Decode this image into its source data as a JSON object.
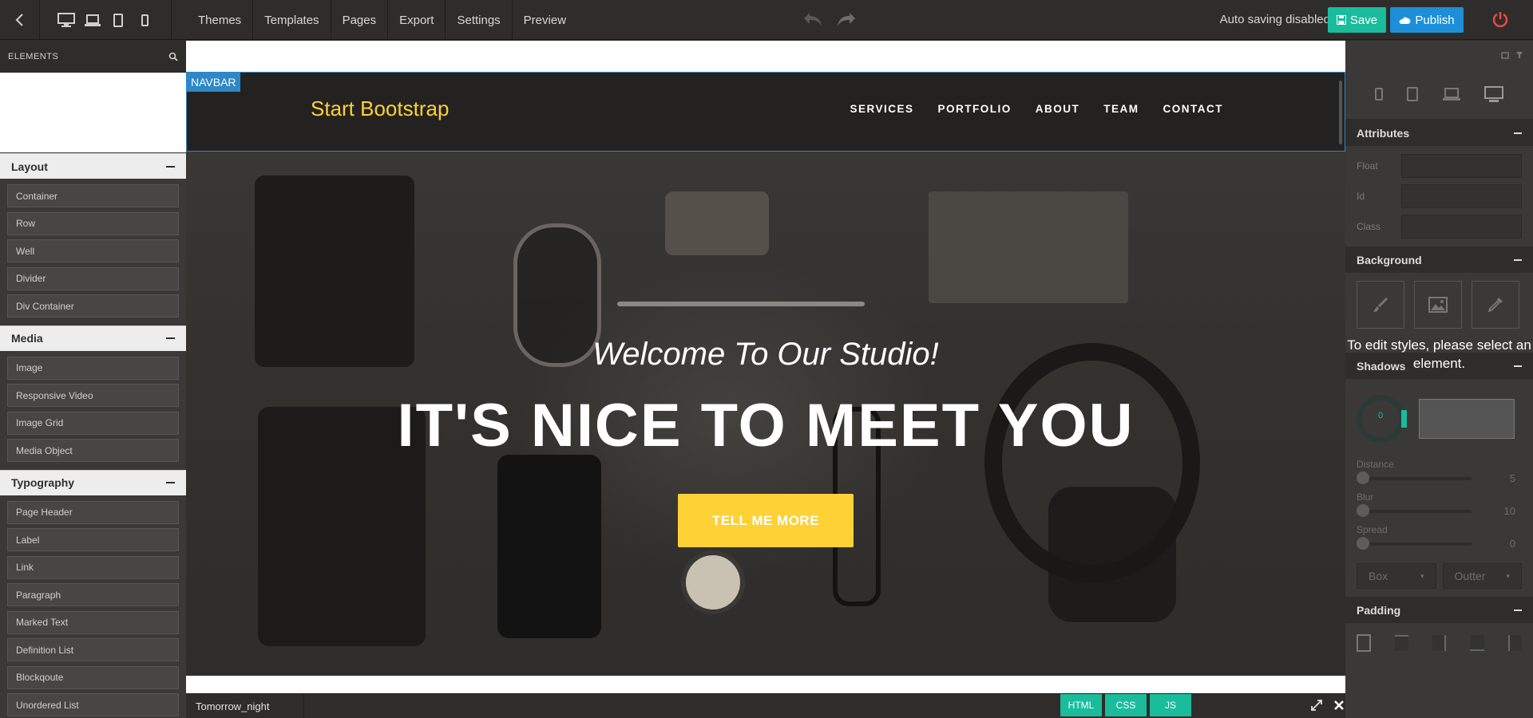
{
  "topbar": {
    "menu": [
      "Themes",
      "Templates",
      "Pages",
      "Export",
      "Settings",
      "Preview"
    ],
    "autosave_text": "Auto saving disabled",
    "save_label": "Save",
    "publish_label": "Publish"
  },
  "left_panel": {
    "header": "ELEMENTS",
    "categories": [
      {
        "name": "Layout",
        "items": [
          "Container",
          "Row",
          "Well",
          "Divider",
          "Div Container"
        ]
      },
      {
        "name": "Media",
        "items": [
          "Image",
          "Responsive Video",
          "Image Grid",
          "Media Object"
        ]
      },
      {
        "name": "Typography",
        "items": [
          "Page Header",
          "Label",
          "Link",
          "Paragraph",
          "Marked Text",
          "Definition List",
          "Blockqoute",
          "Unordered List"
        ]
      }
    ]
  },
  "canvas": {
    "navbar_tag": "NAVBAR",
    "brand": "Start Bootstrap",
    "nav_links": [
      "SERVICES",
      "PORTFOLIO",
      "ABOUT",
      "TEAM",
      "CONTACT"
    ],
    "hero_subtitle": "Welcome To Our Studio!",
    "hero_title": "IT'S NICE TO MEET YOU",
    "hero_button": "TELL ME MORE",
    "accent_color": "#fed136"
  },
  "right_panel": {
    "sections": {
      "attributes": "Attributes",
      "background": "Background",
      "shadows": "Shadows",
      "padding": "Padding"
    },
    "attr_fields": [
      "Float",
      "Id",
      "Class"
    ],
    "bg_tiles": [
      "paint-brush-icon",
      "image-icon",
      "eyedropper-icon"
    ],
    "overlay_message": "To edit styles, please select an element.",
    "shadow_circle_value": "0",
    "sliders": [
      {
        "label": "Distance",
        "value": "5"
      },
      {
        "label": "Blur",
        "value": "10"
      },
      {
        "label": "Spread",
        "value": "0"
      }
    ],
    "selects": [
      "Box",
      "Outter"
    ]
  },
  "bottombar": {
    "theme": "Tomorrow_night",
    "tabs": [
      "HTML",
      "CSS",
      "JS"
    ]
  },
  "colors": {
    "save": "#1abc9c",
    "publish": "#1d8fd8",
    "selection": "#2e87c6",
    "power": "#e74c3c"
  }
}
